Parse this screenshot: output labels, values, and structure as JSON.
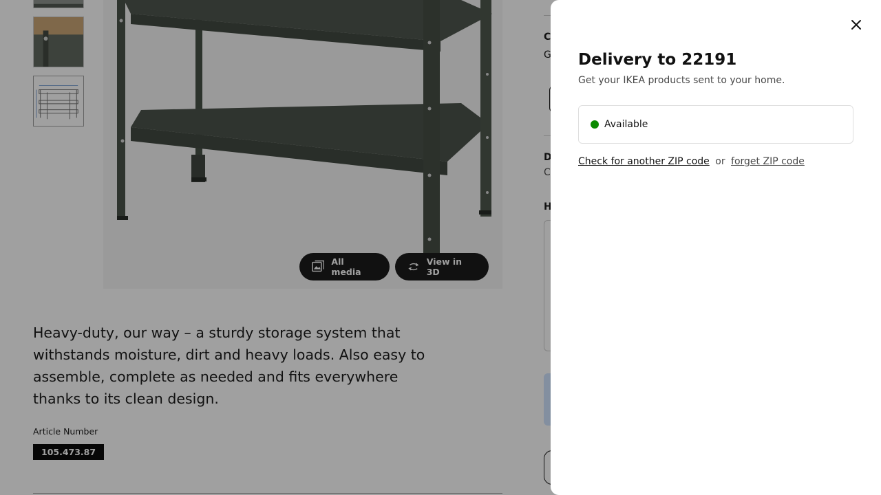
{
  "product": {
    "summary": "Heavy-duty, our way – a sturdy storage system that withstands moisture, dirt and heavy loads. Also easy to assemble, complete as needed and fits everywhere thanks to its clean design.",
    "article_label": "Article Number",
    "article_number": "105.473.87"
  },
  "media": {
    "all_media_label": "All media",
    "all_media_icon": "gallery-icon",
    "view_3d_label": "View in 3D",
    "view_3d_icon": "rotate-3d-icon"
  },
  "sidebar_peek": {
    "letters": [
      "C",
      "G",
      "D",
      "C",
      "H"
    ]
  },
  "delivery_panel": {
    "title": "Delivery to 22191",
    "subtitle": "Get your IKEA products sent to your home.",
    "status": "Available",
    "status_color": "#0a8a00",
    "check_link": "Check for another ZIP code",
    "separator": "or",
    "forget_link": "forget ZIP code",
    "close_icon": "close-icon"
  }
}
